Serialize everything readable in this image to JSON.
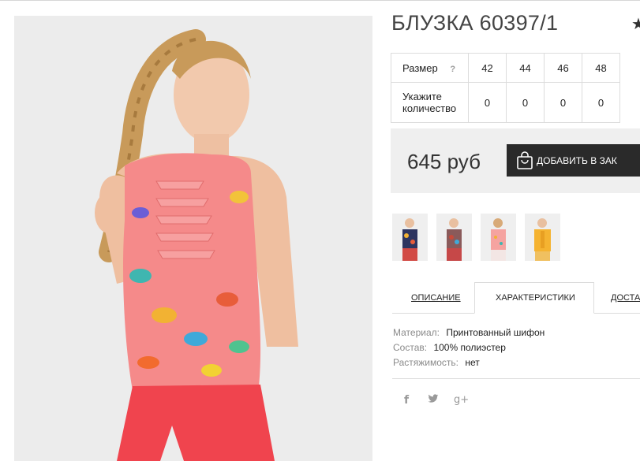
{
  "product": {
    "title": "БЛУЗКА 60397/1",
    "price": "645 руб",
    "add_to_cart": "ДОБАВИТЬ В ЗАК"
  },
  "size_table": {
    "size_label": "Размер",
    "help": "?",
    "sizes": [
      "42",
      "44",
      "46",
      "48"
    ],
    "quantity_label_line1": "Укажите",
    "quantity_label_line2": "количество",
    "quantities": [
      "0",
      "0",
      "0",
      "0"
    ]
  },
  "tabs": {
    "description": "ОПИСАНИЕ",
    "characteristics": "ХАРАКТЕРИСТИКИ",
    "delivery": "ДОСТА"
  },
  "characteristics": [
    {
      "label": "Материал:",
      "value": "Принтованный шифон"
    },
    {
      "label": "Состав:",
      "value": "100% полиэстер"
    },
    {
      "label": "Растяжимость:",
      "value": "нет"
    }
  ],
  "social": {
    "facebook": "f",
    "twitter": "🐦",
    "googleplus": "g+"
  },
  "icons": {
    "star": "★",
    "cart": "shopping-bag-icon"
  },
  "colors": {
    "button_bg": "#2a2a2a",
    "price_box_bg": "#efefef",
    "blouse_pink": "#f58a8a",
    "shorts_red": "#f0444e"
  }
}
